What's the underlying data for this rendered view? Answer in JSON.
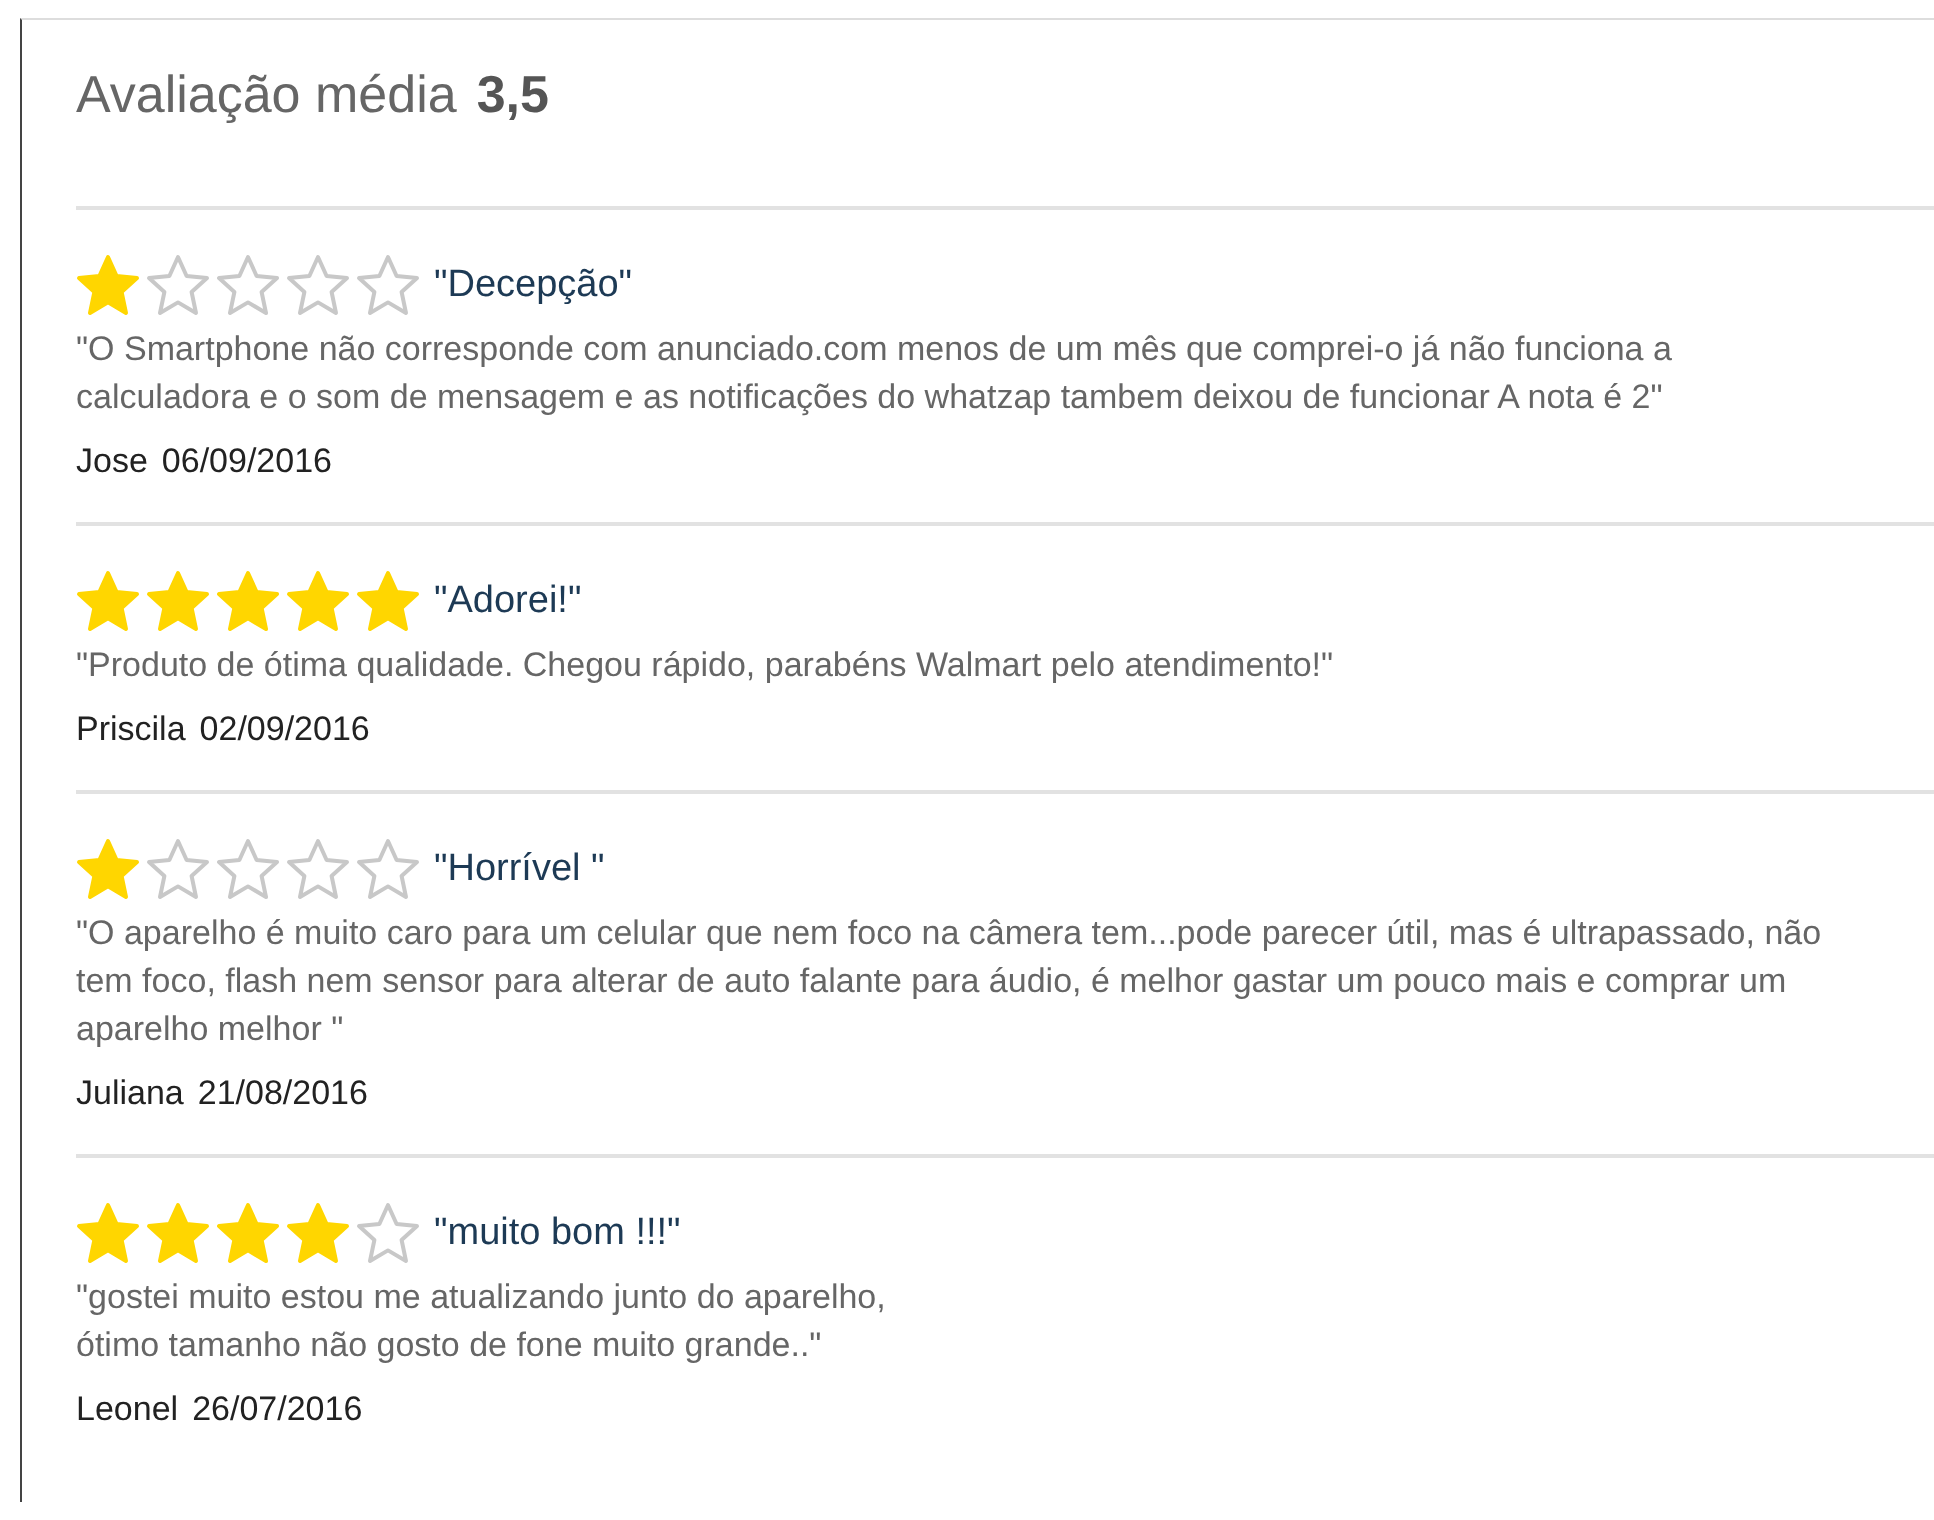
{
  "heading": {
    "label": "Avaliação média",
    "score": "3,5"
  },
  "reviews": [
    {
      "stars": 1,
      "title": "\"Decepção\"",
      "body": "\"O Smartphone não corresponde com anunciado.com menos de um mês que comprei-o já não funciona a calculadora e o som de mensagem e as notificações do whatzap tambem deixou de funcionar A nota é 2\"",
      "author": "Jose",
      "date": "06/09/2016"
    },
    {
      "stars": 5,
      "title": "\"Adorei!\"",
      "body": "\"Produto de ótima qualidade. Chegou rápido, parabéns Walmart pelo atendimento!\"",
      "author": "Priscila",
      "date": "02/09/2016"
    },
    {
      "stars": 1,
      "title": "\"Horrível \"",
      "body": "\"O aparelho é muito caro para um celular que nem foco na câmera tem...pode parecer útil, mas é ultrapassado, não tem foco, flash nem sensor para alterar de auto falante para áudio, é melhor gastar um pouco mais e comprar um aparelho melhor \"",
      "author": "Juliana",
      "date": "21/08/2016"
    },
    {
      "stars": 4,
      "title": "\"muito bom !!!\"",
      "body": "\"gostei muito estou me atualizando junto do aparelho,\nótimo tamanho não gosto de fone muito grande..\"",
      "author": "Leonel",
      "date": "26/07/2016"
    }
  ]
}
